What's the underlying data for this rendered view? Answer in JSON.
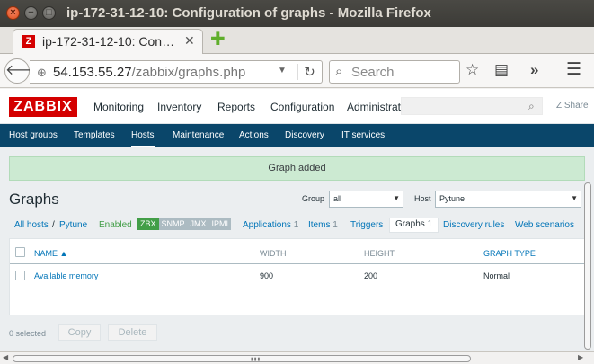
{
  "window": {
    "title": "ip-172-31-12-10: Configuration of graphs - Mozilla Firefox",
    "close_glyph": "×",
    "min_glyph": "−",
    "max_glyph": "□"
  },
  "tab": {
    "favicon_letter": "Z",
    "title": "ip-172-31-12-10: Con…",
    "close_glyph": "✕",
    "new_tab_glyph": "✚"
  },
  "nav": {
    "url_host": "54.153.55.27",
    "url_path": "/zabbix/graphs.php",
    "search_placeholder": "Search"
  },
  "zabbix": {
    "logo": "ZABBIX",
    "top_menu": [
      "Monitoring",
      "Inventory",
      "Reports",
      "Configuration",
      "Administration"
    ],
    "share_label": "Share",
    "sub_menu": [
      "Host groups",
      "Templates",
      "Hosts",
      "Maintenance",
      "Actions",
      "Discovery",
      "IT services"
    ],
    "message": "Graph added",
    "page_title": "Graphs",
    "filter": {
      "group_label": "Group",
      "group_value": "all",
      "host_label": "Host",
      "host_value": "Pytune"
    },
    "host_nav": {
      "all_hosts": "All hosts",
      "separator": "/",
      "host": "Pytune",
      "status": "Enabled",
      "availability": [
        "ZBX",
        "SNMP",
        "JMX",
        "IPMI"
      ],
      "applications": "Applications",
      "applications_count": "1",
      "items": "Items",
      "items_count": "1",
      "triggers": "Triggers",
      "graphs": "Graphs",
      "graphs_count": "1",
      "discovery": "Discovery rules",
      "web": "Web scenarios"
    },
    "table": {
      "headers": {
        "name": "NAME ▲",
        "width": "WIDTH",
        "height": "HEIGHT",
        "graph_type": "GRAPH TYPE"
      },
      "rows": [
        {
          "name": "Available memory",
          "width": "900",
          "height": "200",
          "graph_type": "Normal"
        }
      ]
    },
    "footer": {
      "selected": "0 selected",
      "copy": "Copy",
      "delete": "Delete"
    }
  }
}
